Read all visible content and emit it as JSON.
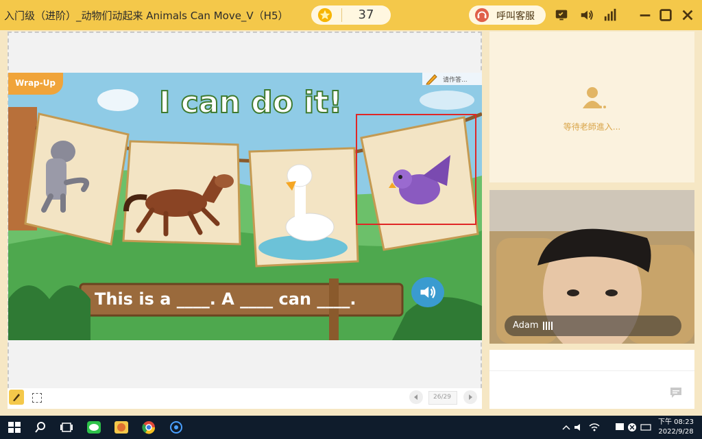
{
  "window": {
    "title": "入门级（进阶）_动物们动起来 Animals Can Move_V（H5）",
    "star_count": "37",
    "support_label": "呼叫客服"
  },
  "slide": {
    "badge": "Wrap-Up",
    "headline": "I can do it!",
    "sentence": "This is a ____. A ____ can ____.",
    "note": "请作答..."
  },
  "pager": {
    "page": "26/29"
  },
  "teacher_panel": {
    "waiting_text": "等待老師進入..."
  },
  "student_panel": {
    "name": "Adam"
  },
  "taskbar": {
    "time": "下午 08:23",
    "date": "2022/9/28"
  },
  "colors": {
    "titlebar": "#f4c84a",
    "highlight": "#e02626",
    "taskbar": "#0f1c2c"
  }
}
